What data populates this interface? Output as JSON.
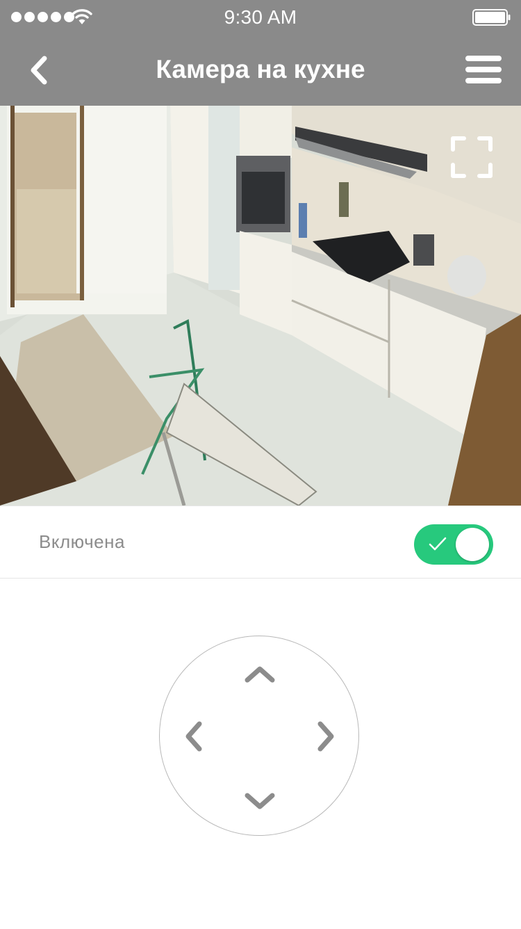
{
  "status_bar": {
    "time": "9:30 AM",
    "signal_icon": "signal-dots-icon",
    "wifi_icon": "wifi-icon",
    "battery_icon": "battery-icon"
  },
  "nav": {
    "title": "Камера на кухне",
    "back_icon": "chevron-left-icon",
    "menu_icon": "hamburger-menu-icon",
    "background_color": "#8a8a8a"
  },
  "camera": {
    "fullscreen_icon": "fullscreen-icon"
  },
  "camera_toggle": {
    "label": "Включена",
    "checked": true,
    "active_color": "#27c97d",
    "check_icon": "checkmark-icon"
  },
  "ptz_control": {
    "up_icon": "chevron-up-icon",
    "down_icon": "chevron-down-icon",
    "left_icon": "chevron-left-icon",
    "right_icon": "chevron-right-icon",
    "arrow_color": "#8c8c8c"
  }
}
